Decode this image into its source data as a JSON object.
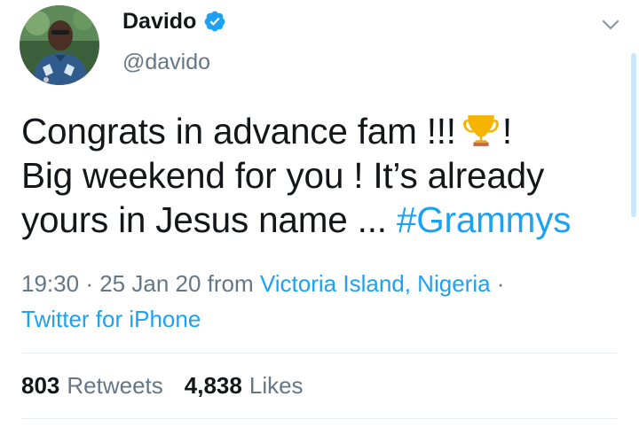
{
  "tweet": {
    "author": {
      "display_name": "Davido",
      "handle": "@davido",
      "verified": true
    },
    "text_lines": {
      "line1_before_emoji": "Congrats in advance fam !!!",
      "line1_after_emoji": "!",
      "line2": "Big weekend for you ! It’s already",
      "line3_text": "yours in Jesus name ...",
      "hashtag": "#Grammys"
    },
    "emoji": "trophy-icon",
    "meta": {
      "time": "19:30",
      "separator": "·",
      "date": "25 Jan 20",
      "from_label": "from",
      "location": "Victoria Island, Nigeria",
      "source": "Twitter for iPhone"
    },
    "stats": {
      "retweets_count": "803",
      "retweets_label": "Retweets",
      "likes_count": "4,838",
      "likes_label": "Likes"
    }
  },
  "colors": {
    "link": "#1da1f2",
    "verified_badge": "#1da1f2",
    "muted_text": "#657786",
    "primary_text": "#14171a",
    "divider": "#e6ecf0"
  }
}
